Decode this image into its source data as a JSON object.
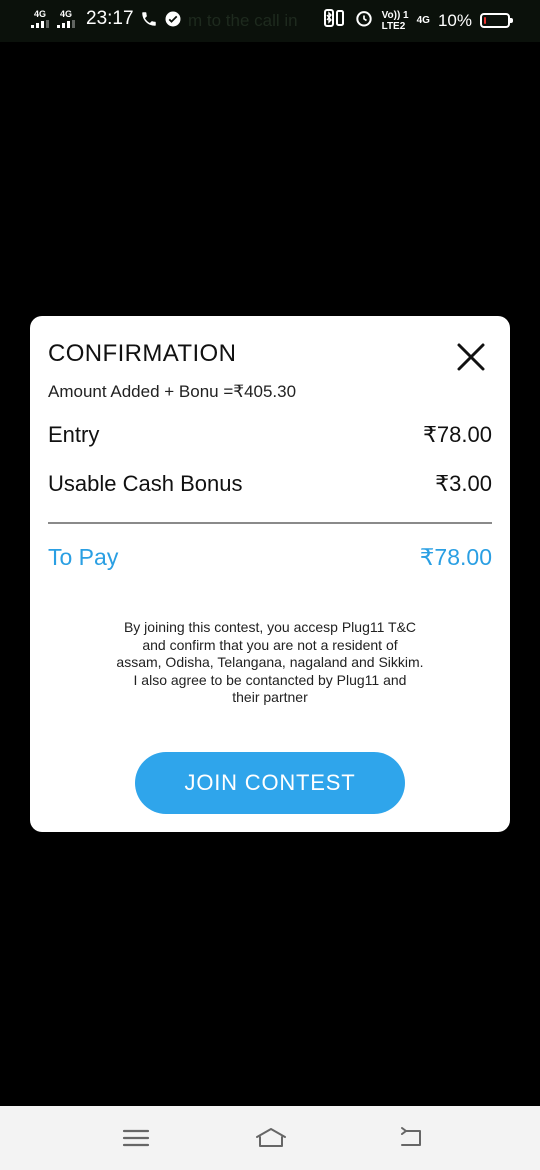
{
  "status_bar": {
    "sim1_network": "4G",
    "sim2_network": "4G",
    "time": "23:17",
    "ghost_notification_text": "m to the call in",
    "volte_line1": "Vo)) 1",
    "volte_line2": "LTE2",
    "right_network": "4G",
    "battery_percent": "10%",
    "battery_level": 0.1,
    "battery_color": "#e8322f"
  },
  "dialog": {
    "title": "CONFIRMATION",
    "subtitle": "Amount Added + Bonu =₹405.30",
    "entry_label": "Entry",
    "entry_value": "₹78.00",
    "bonus_label": "Usable Cash Bonus",
    "bonus_value": "₹3.00",
    "to_pay_label": "To Pay",
    "to_pay_value": "₹78.00",
    "terms_lines": [
      "By joining this contest, you accesp Plug11 T&C",
      "and confirm that you are not a resident of",
      "assam, Odisha, Telangana, nagaland and Sikkim.",
      "I also agree to be contancted by Plug11 and",
      "their partner"
    ],
    "join_button_label": "JOIN CONTEST",
    "accent_color": "#2fa5eb"
  },
  "icons": {
    "close": "close-icon",
    "menu": "menu-icon",
    "home": "home-icon",
    "back": "back-icon"
  }
}
